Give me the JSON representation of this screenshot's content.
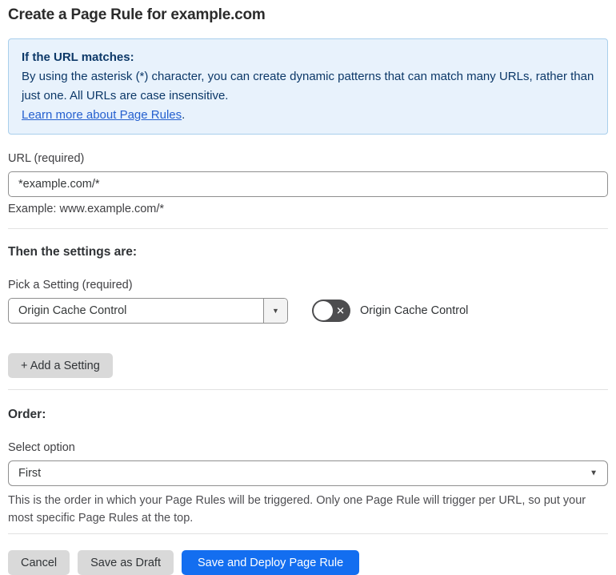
{
  "page": {
    "title": "Create a Page Rule for example.com"
  },
  "info_box": {
    "heading": "If the URL matches:",
    "body": "By using the asterisk (*) character, you can create dynamic patterns that can match many URLs, rather than just one. All URLs are case insensitive.",
    "link": "Learn more about Page Rules",
    "link_suffix": "."
  },
  "url_field": {
    "label": "URL (required)",
    "value": "*example.com/*",
    "example": "Example: www.example.com/*"
  },
  "settings_section": {
    "heading": "Then the settings are:",
    "picker_label": "Pick a Setting (required)",
    "picker_value": "Origin Cache Control",
    "toggle_label": "Origin Cache Control",
    "toggle_state": "off",
    "add_setting_label": "+ Add a Setting"
  },
  "order_section": {
    "heading": "Order:",
    "select_label": "Select option",
    "select_value": "First",
    "help": "This is the order in which your Page Rules will be triggered. Only one Page Rule will trigger per URL, so put your most specific Page Rules at the top."
  },
  "footer": {
    "cancel_label": "Cancel",
    "save_draft_label": "Save as Draft",
    "save_deploy_label": "Save and Deploy Page Rule"
  },
  "icons": {
    "dropdown_arrow": "▼",
    "toggle_off_x": "✕"
  },
  "colors": {
    "primary_button": "#136ef0",
    "info_box_bg": "#e8f2fc",
    "info_box_border": "#a9cfec",
    "info_box_text": "#0c3868",
    "link": "#2560cf",
    "toggle_off_track": "#4d4d4f",
    "gray_button": "#d9d9d9"
  }
}
